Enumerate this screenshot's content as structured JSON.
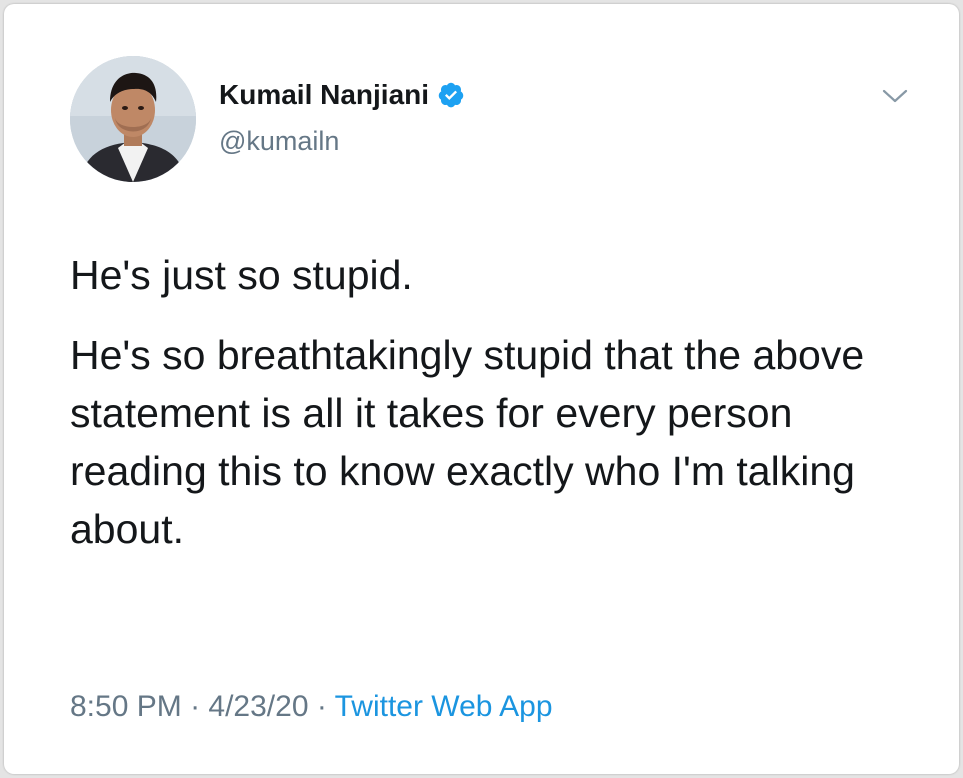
{
  "author": {
    "display_name": "Kumail Nanjiani",
    "handle": "@kumailn",
    "verified": true,
    "avatar_icon": "profile-photo"
  },
  "tweet": {
    "line1": "He's just so stupid.",
    "line2": "He's so breathtakingly stupid that the above statement is all it takes for every person reading this to know exactly who I'm talking about."
  },
  "meta": {
    "time": "8:50 PM",
    "separator": " · ",
    "date": "4/23/20",
    "source": "Twitter Web App"
  },
  "colors": {
    "verified_blue": "#1da1f2",
    "link_blue": "#1b95e0",
    "muted_gray": "#657786",
    "text": "#14171a"
  },
  "icons": {
    "verified": "verified-badge-icon",
    "menu": "chevron-down-icon"
  }
}
